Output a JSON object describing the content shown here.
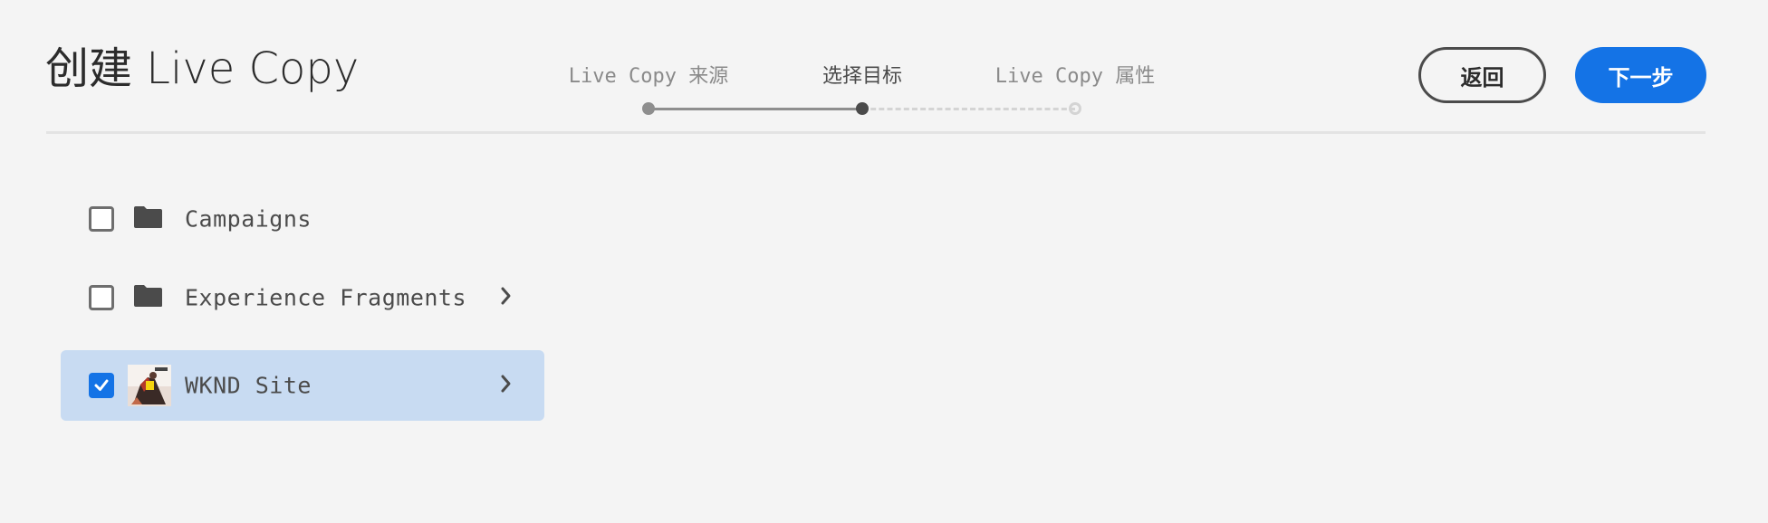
{
  "header": {
    "title": "创建 Live Copy",
    "back_label": "返回",
    "next_label": "下一步"
  },
  "wizard": {
    "steps": [
      {
        "label": "Live Copy 来源",
        "state": "done"
      },
      {
        "label": "选择目标",
        "state": "current"
      },
      {
        "label": "Live Copy 属性",
        "state": "todo"
      }
    ]
  },
  "list": {
    "items": [
      {
        "label": "Campaigns",
        "icon": "folder-icon",
        "checked": false,
        "has_children": false
      },
      {
        "label": "Experience Fragments",
        "icon": "folder-icon",
        "checked": false,
        "has_children": true
      },
      {
        "label": "WKND Site",
        "icon": "site-thumbnail",
        "checked": true,
        "has_children": true
      }
    ]
  },
  "colors": {
    "accent": "#1473e6",
    "selected_row": "#c8dbf2",
    "background": "#f4f4f4"
  }
}
